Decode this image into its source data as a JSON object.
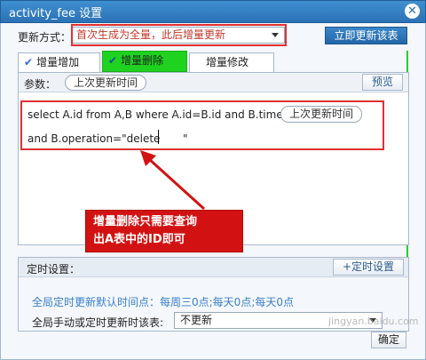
{
  "window": {
    "title": "activity_fee 设置"
  },
  "update": {
    "label": "更新方式：",
    "mode_value": "首次生成为全量，此后增量更新",
    "update_now_button": "立即更新该表"
  },
  "tabs": [
    {
      "label": "增量增加",
      "checked": true
    },
    {
      "label": "增量删除",
      "checked": true,
      "highlight": "#1fd21f"
    },
    {
      "label": "增量修改",
      "checked": false
    }
  ],
  "params": {
    "label": "参数：",
    "param_pill": "上次更新时间",
    "preview_button": "预览"
  },
  "sql": {
    "line1": "select A.id from A,B where A.id=B.id and B.time<",
    "line1_pill": "上次更新时间",
    "line2": "and B.operation=\"delete",
    "line2_tail": "\""
  },
  "annotation": {
    "line1": "增量删除只需要查询",
    "line2": "出A表中的ID即可"
  },
  "schedule": {
    "label": "定时设置：",
    "add_button": "+定时设置",
    "default_info": "全局定时更新默认时间点：每周三0点;每天0点;每天0点",
    "manual_label": "全局手动或定时更新时该表:",
    "manual_value": "不更新",
    "ok_button": "确定"
  },
  "watermark": "jingyan.baidu.com",
  "colors": {
    "title_blue": "#2b72b5",
    "accent_red": "#e03030",
    "tab_green": "#1fd21f"
  }
}
